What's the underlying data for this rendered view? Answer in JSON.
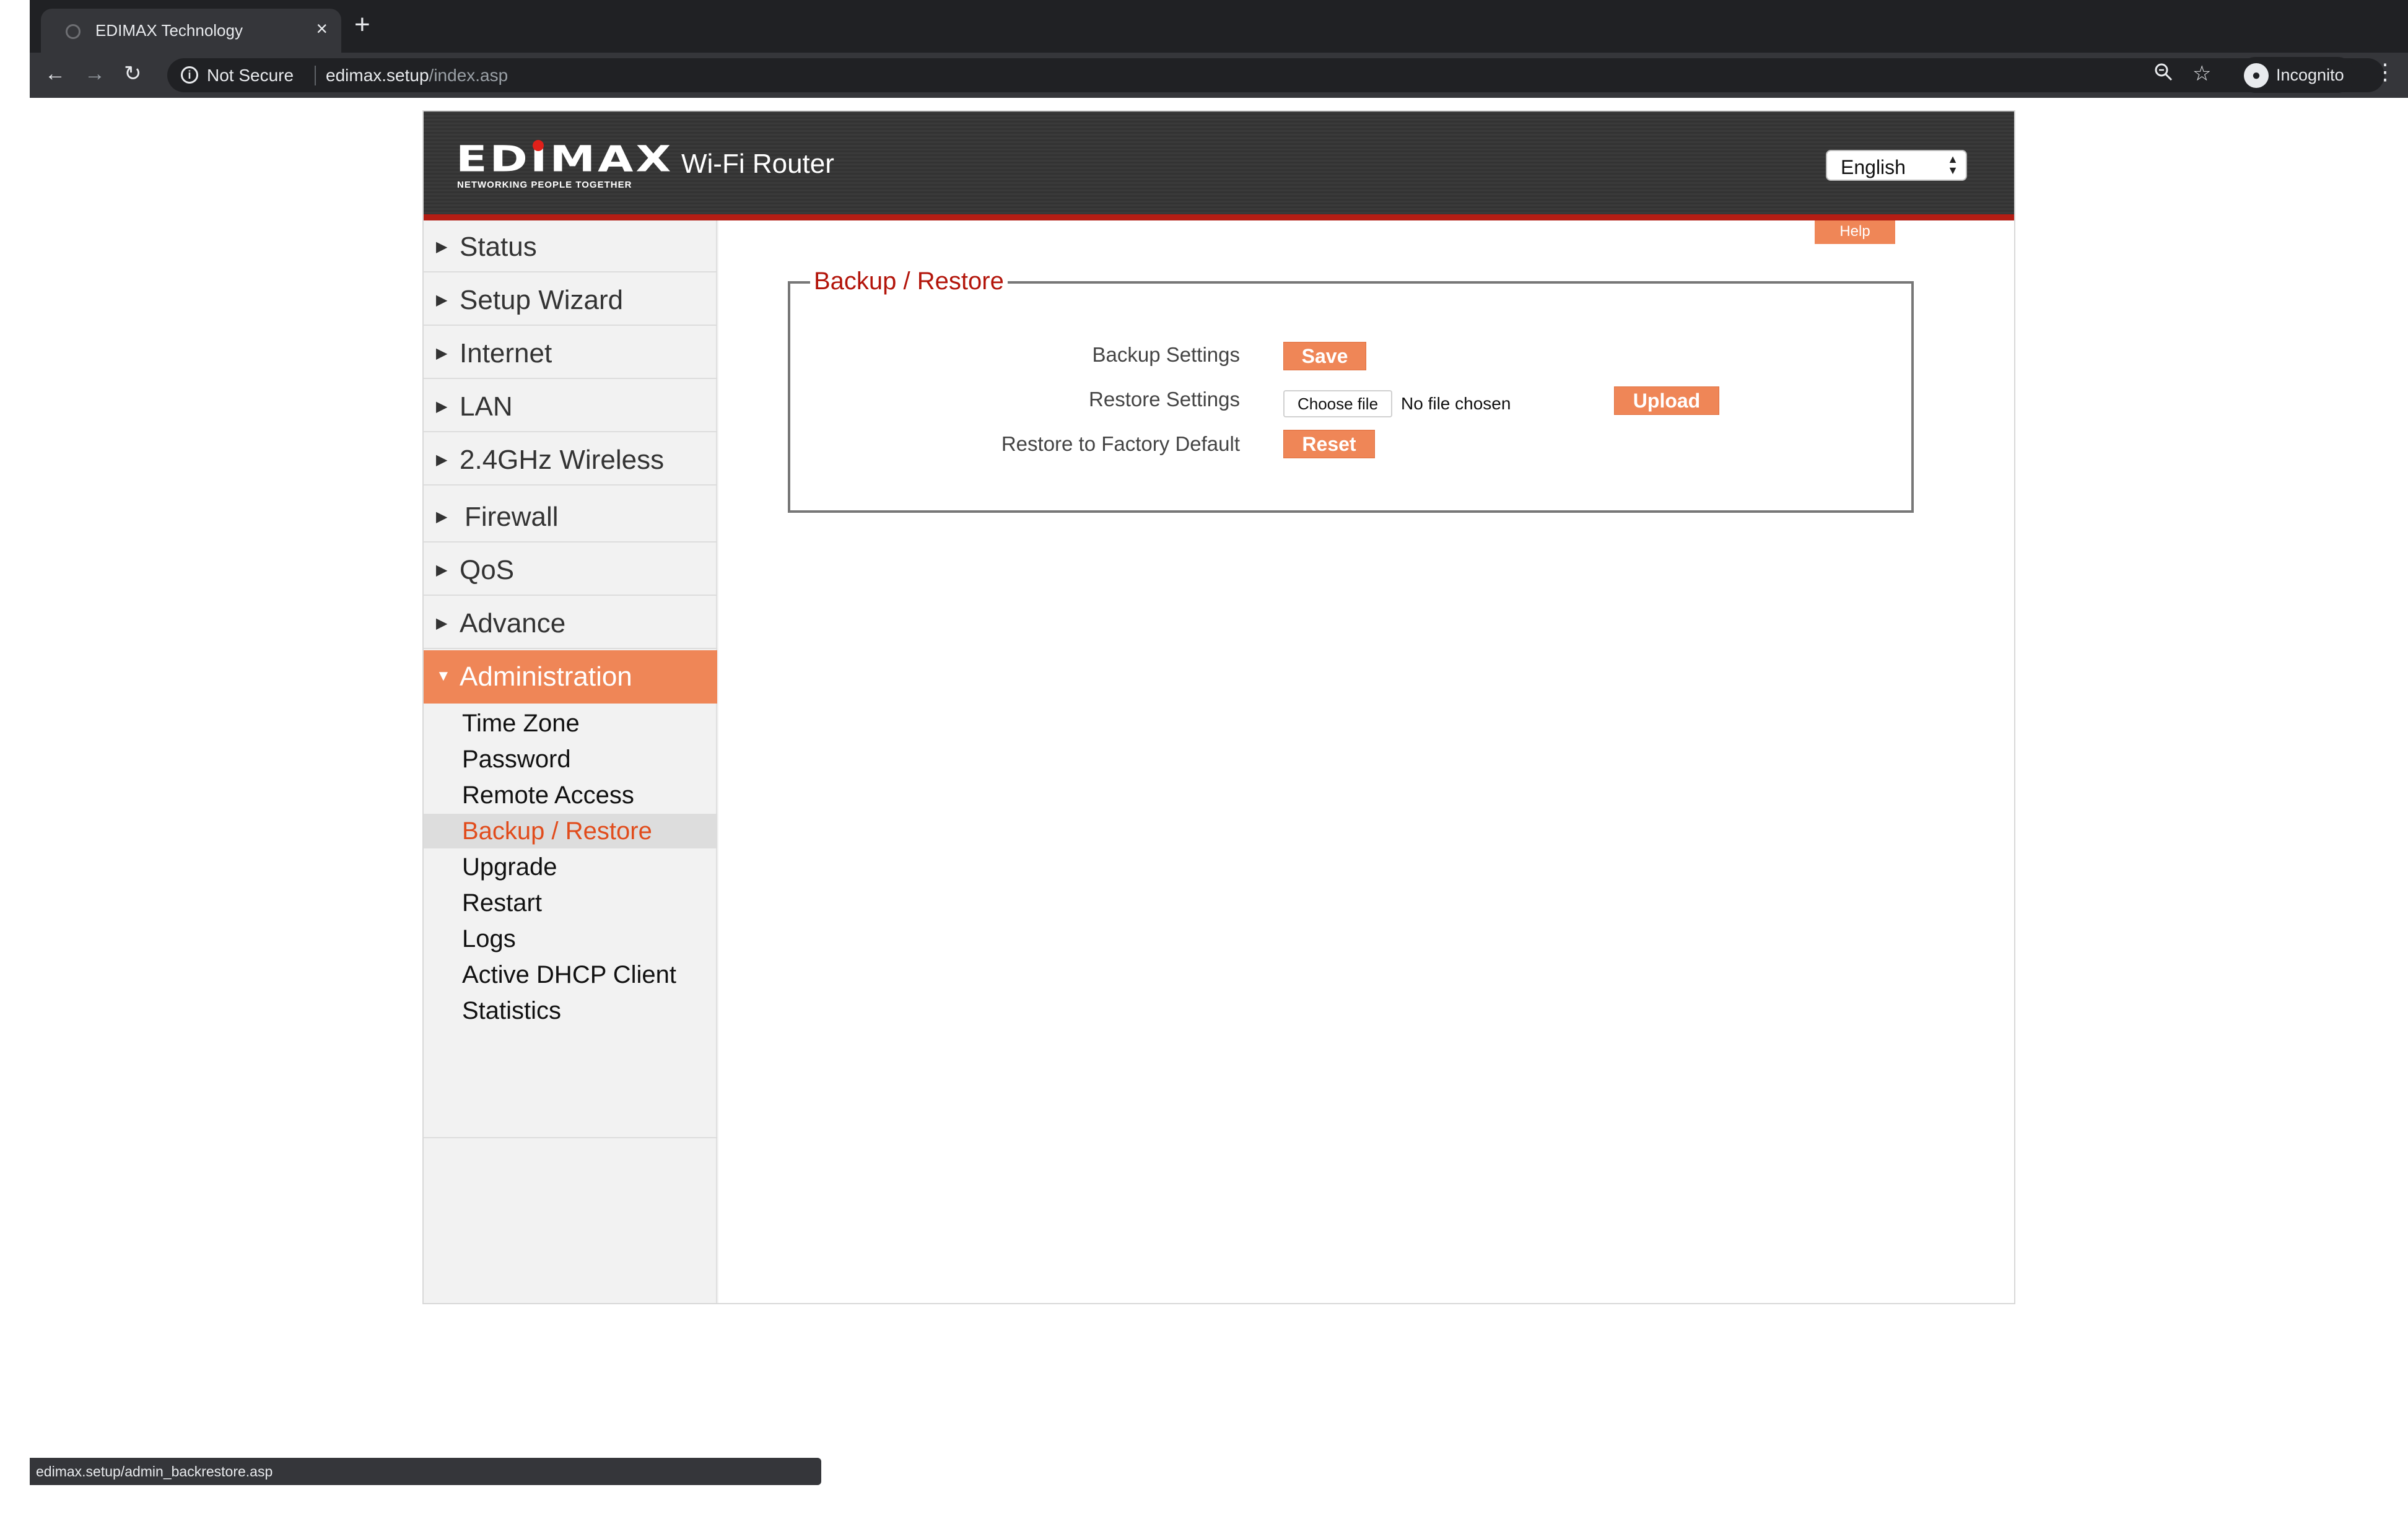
{
  "browser": {
    "tab_title": "EDIMAX Technology",
    "tab_close": "×",
    "new_tab": "+",
    "back": "←",
    "forward": "→",
    "reload": "↻",
    "security_label": "Not Secure",
    "url_host": "edimax.setup",
    "url_path": "/index.asp",
    "profile_label": "Incognito",
    "status_url": "edimax.setup/admin_backrestore.asp"
  },
  "header": {
    "logo_text": "EDIMAX",
    "logo_tagline": "NETWORKING PEOPLE TOGETHER",
    "product_name": "Wi-Fi Router",
    "language": "English"
  },
  "sidebar": {
    "items": [
      {
        "label": "Status",
        "arrow": "▶"
      },
      {
        "label": "Setup Wizard",
        "arrow": "▶"
      },
      {
        "label": "Internet",
        "arrow": "▶"
      },
      {
        "label": "LAN",
        "arrow": "▶"
      },
      {
        "label": "2.4GHz Wireless",
        "arrow": "▶"
      },
      {
        "label": "Firewall",
        "arrow": "▶"
      },
      {
        "label": "QoS",
        "arrow": "▶"
      },
      {
        "label": "Advance",
        "arrow": "▶"
      },
      {
        "label": "Administration",
        "arrow": "▼"
      }
    ],
    "subitems": [
      {
        "label": "Time Zone"
      },
      {
        "label": "Password"
      },
      {
        "label": "Remote Access"
      },
      {
        "label": "Backup / Restore"
      },
      {
        "label": "Upgrade"
      },
      {
        "label": "Restart"
      },
      {
        "label": "Logs"
      },
      {
        "label": "Active DHCP Client"
      },
      {
        "label": "Statistics"
      }
    ]
  },
  "main": {
    "help_label": "Help",
    "section_title": "Backup / Restore",
    "backup_label": "Backup Settings",
    "save_button": "Save",
    "restore_label": "Restore Settings",
    "choose_file_button": "Choose file",
    "file_status": "No file chosen",
    "upload_button": "Upload",
    "factory_label": "Restore to Factory Default",
    "reset_button": "Reset"
  },
  "colors": {
    "accent": "#ef8657",
    "selected_text": "#e14c1c",
    "legend_red": "#b3150b",
    "header_red": "#b31d14"
  }
}
